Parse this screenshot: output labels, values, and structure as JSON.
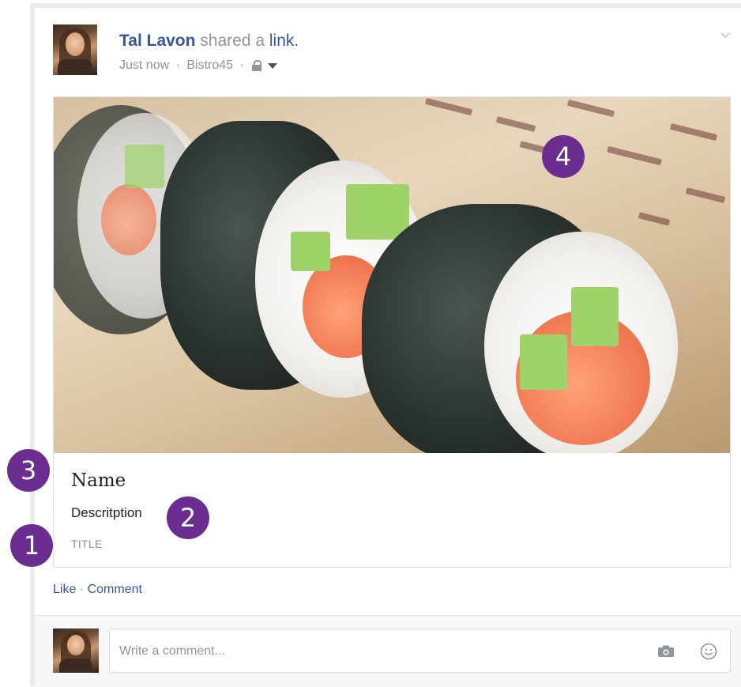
{
  "post": {
    "author": "Tal Lavon",
    "action_text": " shared a ",
    "link_word": "link.",
    "timestamp": "Just now",
    "location": "Bistro45",
    "separator": " · "
  },
  "link_preview": {
    "name": "Name",
    "description": "Descritption",
    "title": "TITLE"
  },
  "annotations": [
    "1",
    "2",
    "3",
    "4"
  ],
  "actions": {
    "like": "Like",
    "separator": " · ",
    "comment": "Comment"
  },
  "comment_box": {
    "placeholder": "Write a comment..."
  },
  "colors": {
    "link_blue": "#365899",
    "meta_gray": "#90949c",
    "badge_purple": "#6b2d8f"
  }
}
